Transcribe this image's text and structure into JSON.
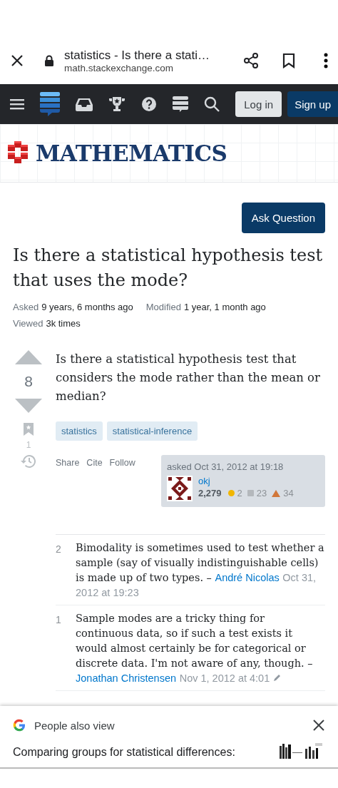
{
  "browser": {
    "title": "statistics - Is there a stati…",
    "url": "math.stackexchange.com"
  },
  "nav": {
    "login": "Log in",
    "signup": "Sign up"
  },
  "site": {
    "name": "MATHEMATICS"
  },
  "ask_button": "Ask Question",
  "question": {
    "title": "Is there a statistical hypothesis test that uses the mode?",
    "meta": [
      {
        "label": "Asked",
        "value": "9 years, 6 months ago"
      },
      {
        "label": "Modified",
        "value": "1 year, 1 month ago"
      },
      {
        "label": "Viewed",
        "value": "3k times"
      }
    ],
    "score": "8",
    "bookmarks": "1",
    "body": "Is there a statistical hypothesis test that considers the mode rather than the mean or median?",
    "tags": [
      "statistics",
      "statistical-inference"
    ],
    "actions": [
      "Share",
      "Cite",
      "Follow"
    ],
    "asked": "asked Oct 31, 2012 at 19:18",
    "user": {
      "name": "okj",
      "rep": "2,279",
      "gold": "2",
      "silver": "23",
      "bronze": "34"
    }
  },
  "comments": [
    {
      "score": "2",
      "text": "Bimodality is sometimes used to test whether a sample (say of visually indistinguishable cells) is made up of two types. –",
      "user": "André Nicolas",
      "date": "Oct 31, 2012 at 19:23",
      "edited": false
    },
    {
      "score": "1",
      "text": "Sample modes are a tricky thing for continuous data, so if such a test exists it would almost certainly be for categorical or discrete data. I'm not aware of any, though. –",
      "user": "Jonathan Christensen",
      "date": "Nov 1, 2012 at 4:01",
      "edited": true
    }
  ],
  "sheet": {
    "heading": "People also view",
    "item": "Comparing groups for statistical differences:"
  }
}
